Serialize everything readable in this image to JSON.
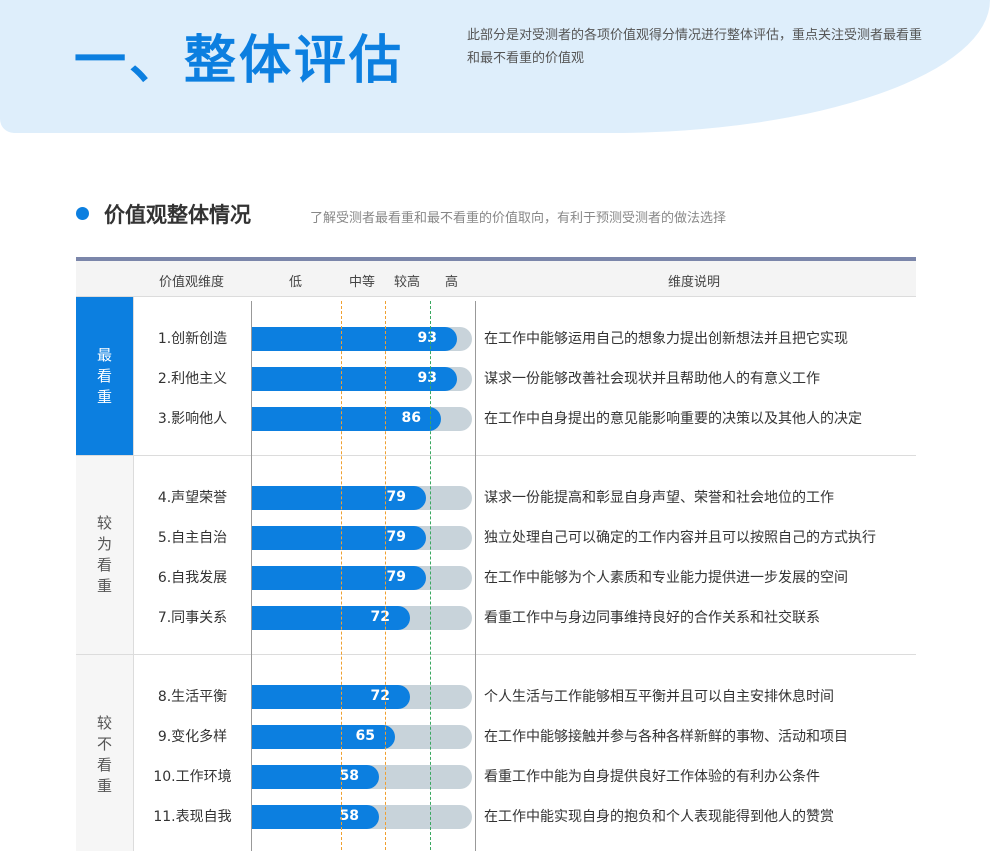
{
  "header": {
    "title": "一、整体评估",
    "description": "此部分是对受测者的各项价值观得分情况进行整体评估，重点关注受测者最看重和最不看重的价值观"
  },
  "section": {
    "title": "价值观整体情况",
    "subtitle": "了解受测者最看重和最不看重的价值取向，有利于预测受测者的做法选择"
  },
  "table": {
    "headers": {
      "dimension": "价值观维度",
      "low": "低",
      "medium": "中等",
      "higher": "较高",
      "high": "高",
      "description": "维度说明"
    },
    "scale_max": 100,
    "groups": [
      {
        "label": "最看重",
        "rows": [
          {
            "name": "1.创新创造",
            "score": 93,
            "desc": "在工作中能够运用自己的想象力提出创新想法并且把它实现"
          },
          {
            "name": "2.利他主义",
            "score": 93,
            "desc": "谋求一份能够改善社会现状并且帮助他人的有意义工作"
          },
          {
            "name": "3.影响他人",
            "score": 86,
            "desc": "在工作中自身提出的意见能影响重要的决策以及其他人的决定"
          }
        ]
      },
      {
        "label": "较为看重",
        "rows": [
          {
            "name": "4.声望荣誉",
            "score": 79,
            "desc": "谋求一份能提高和彰显自身声望、荣誉和社会地位的工作"
          },
          {
            "name": "5.自主自治",
            "score": 79,
            "desc": "独立处理自己可以确定的工作内容并且可以按照自己的方式执行"
          },
          {
            "name": "6.自我发展",
            "score": 79,
            "desc": "在工作中能够为个人素质和专业能力提供进一步发展的空间"
          },
          {
            "name": "7.同事关系",
            "score": 72,
            "desc": "看重工作中与身边同事维持良好的合作关系和社交联系"
          }
        ]
      },
      {
        "label": "较不看重",
        "rows": [
          {
            "name": "8.生活平衡",
            "score": 72,
            "desc": "个人生活与工作能够相互平衡并且可以自主安排休息时间"
          },
          {
            "name": "9.变化多样",
            "score": 65,
            "desc": "在工作中能够接触并参与各种各样新鲜的事物、活动和项目"
          },
          {
            "name": "10.工作环境",
            "score": 58,
            "desc": "看重工作中能为自身提供良好工作体验的有利办公条件"
          },
          {
            "name": "11.表现自我",
            "score": 58,
            "desc": "在工作中能实现自身的抱负和个人表现能得到他人的赞赏"
          }
        ]
      }
    ]
  },
  "colors": {
    "accent": "#0c7fe0",
    "track": "#c8d3da",
    "banner": "#deeefb"
  }
}
